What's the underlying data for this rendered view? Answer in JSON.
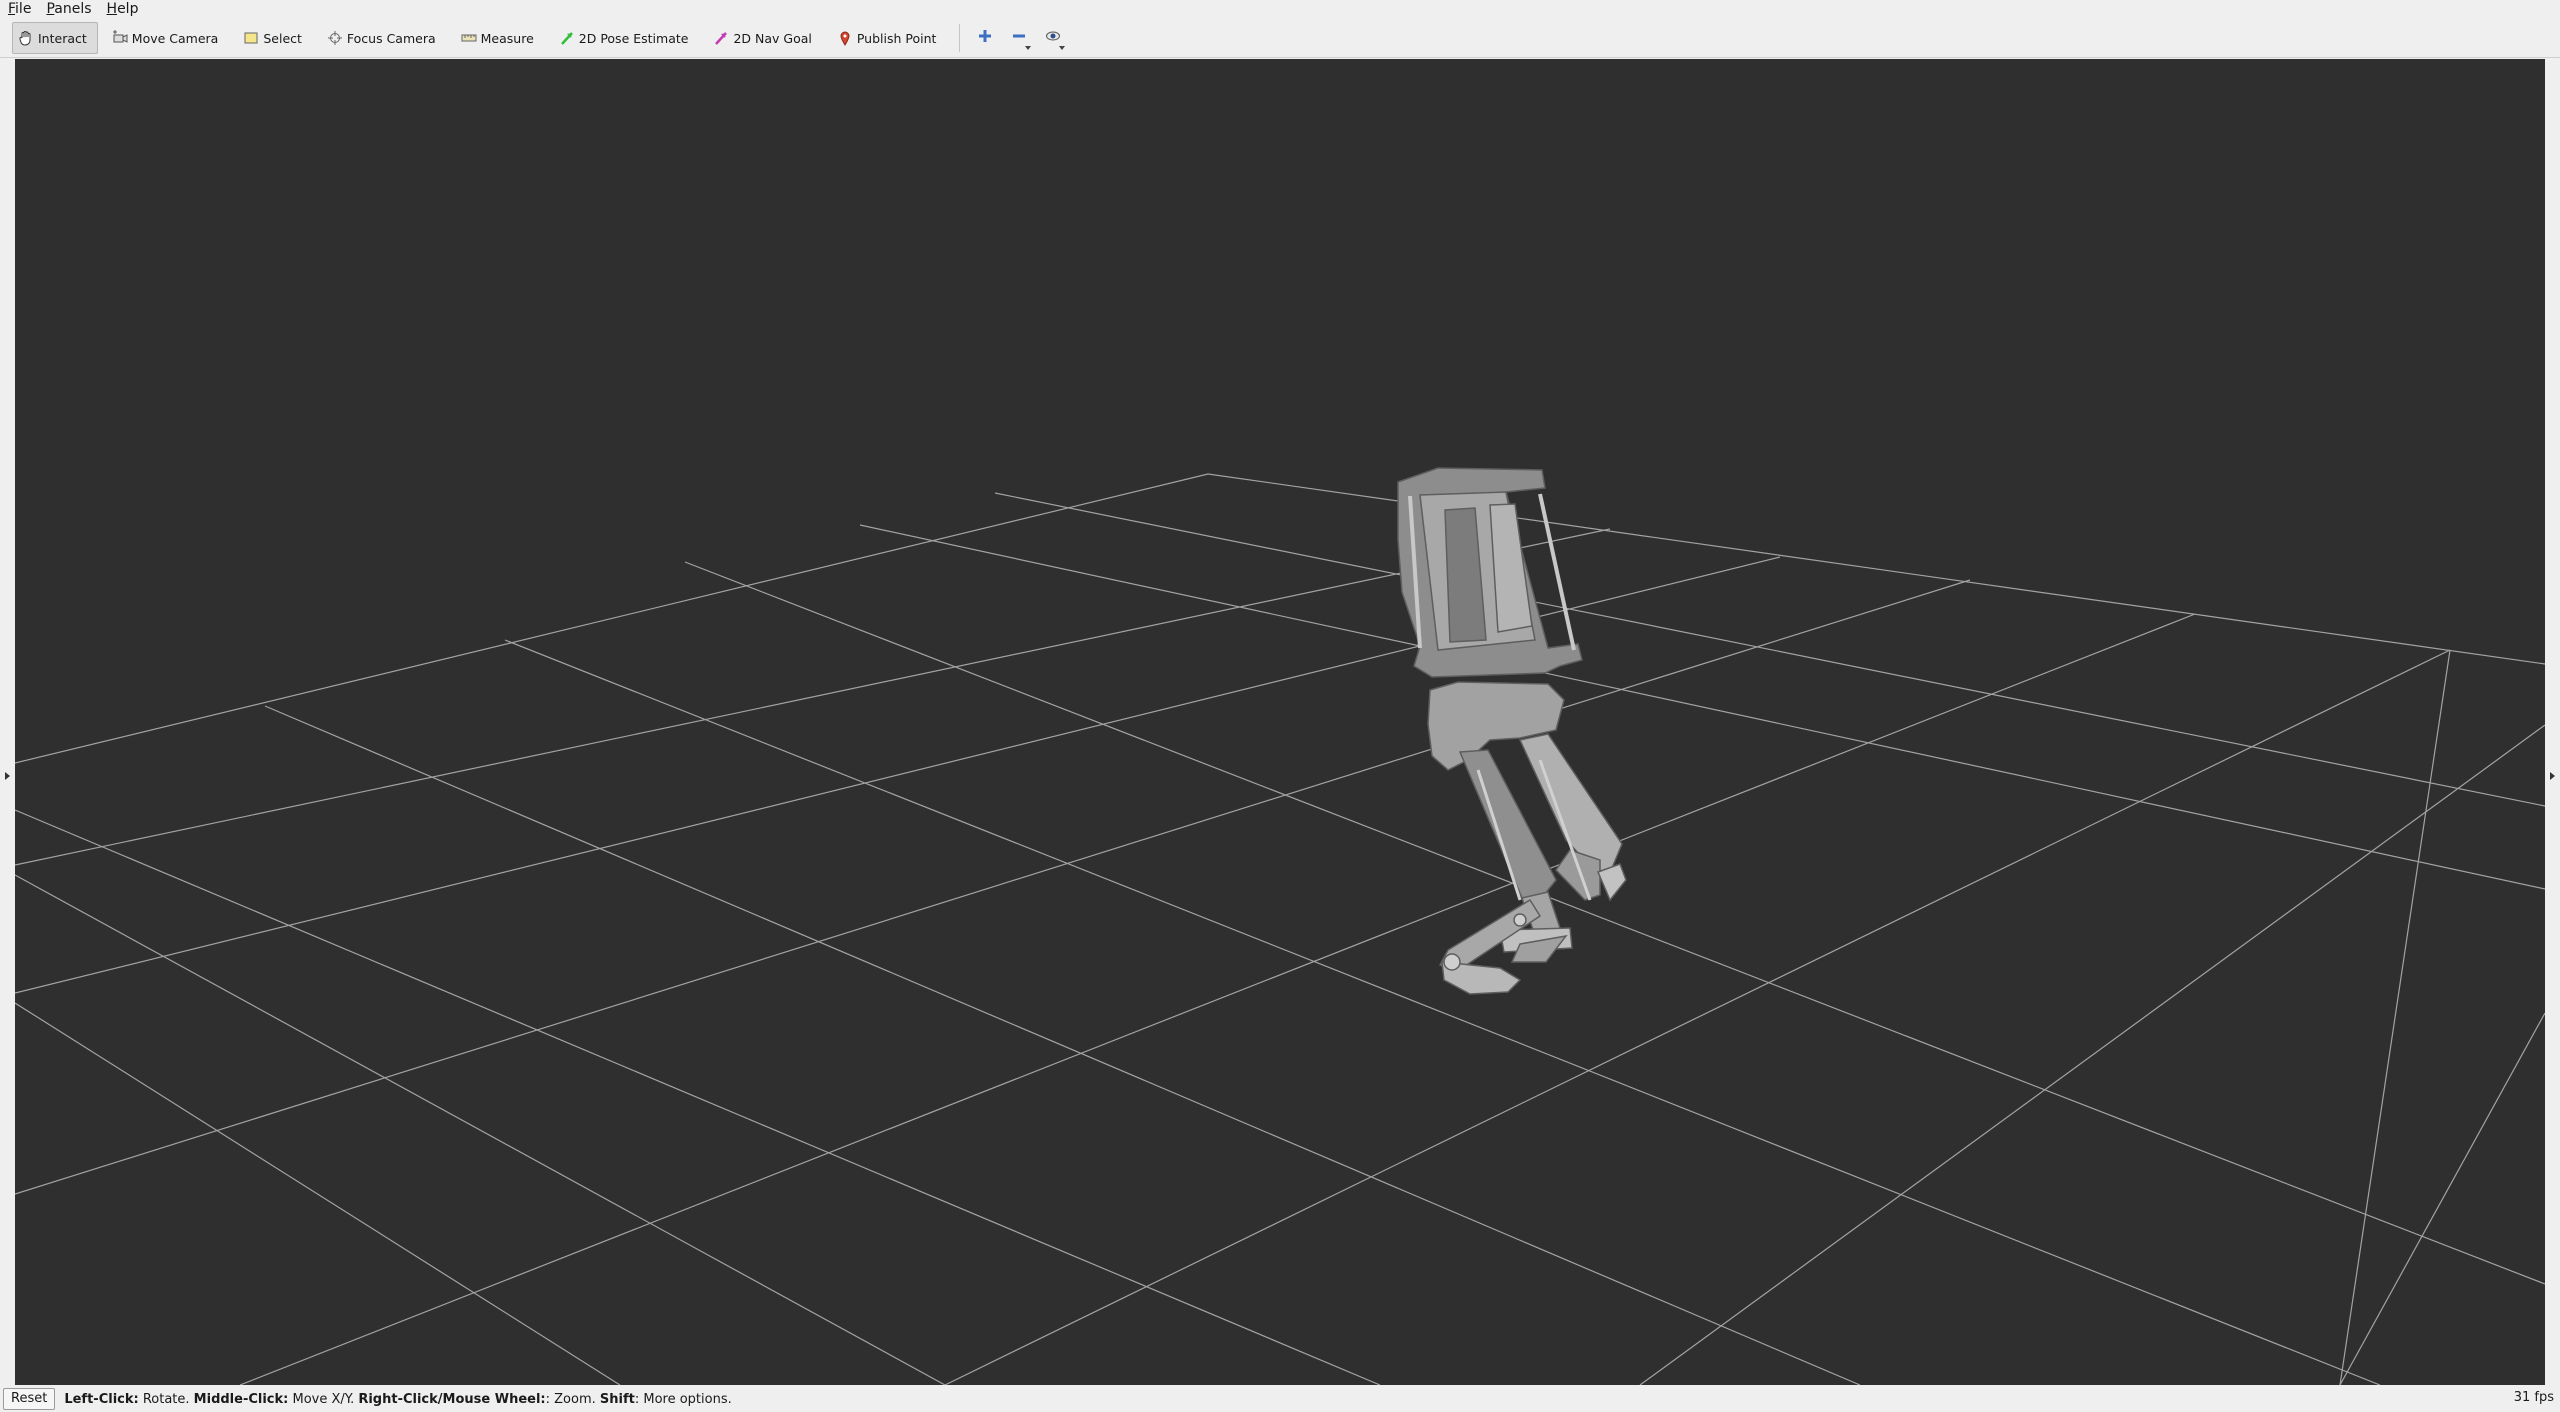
{
  "menubar": {
    "items": [
      "File",
      "Panels",
      "Help"
    ]
  },
  "toolbar": {
    "tools": [
      {
        "label": "Interact",
        "icon": "hand-cursor-icon",
        "active": true
      },
      {
        "label": "Move Camera",
        "icon": "move-camera-icon",
        "active": false
      },
      {
        "label": "Select",
        "icon": "select-rectangle-icon",
        "active": false
      },
      {
        "label": "Focus Camera",
        "icon": "focus-crosshair-icon",
        "active": false
      },
      {
        "label": "Measure",
        "icon": "ruler-icon",
        "active": false
      },
      {
        "label": "2D Pose Estimate",
        "icon": "green-arrow-icon",
        "active": false
      },
      {
        "label": "2D Nav Goal",
        "icon": "magenta-arrow-icon",
        "active": false
      },
      {
        "label": "Publish Point",
        "icon": "map-pin-icon",
        "active": false
      }
    ],
    "extra_icons": [
      "add-tool-icon",
      "remove-tool-icon",
      "camera-view-icon"
    ]
  },
  "viewport": {
    "background": "#2f2f2f",
    "grid_color": "#a0a0a0",
    "model": "bipedal-robot-mesh"
  },
  "statusbar": {
    "reset_label": "Reset",
    "hint": [
      {
        "bold": "Left-Click:",
        "text": " Rotate. "
      },
      {
        "bold": "Middle-Click:",
        "text": " Move X/Y. "
      },
      {
        "bold": "Right-Click/Mouse Wheel:",
        "text": ": Zoom. "
      },
      {
        "bold": "Shift",
        "text": ": More options."
      }
    ],
    "fps": "31 fps"
  }
}
